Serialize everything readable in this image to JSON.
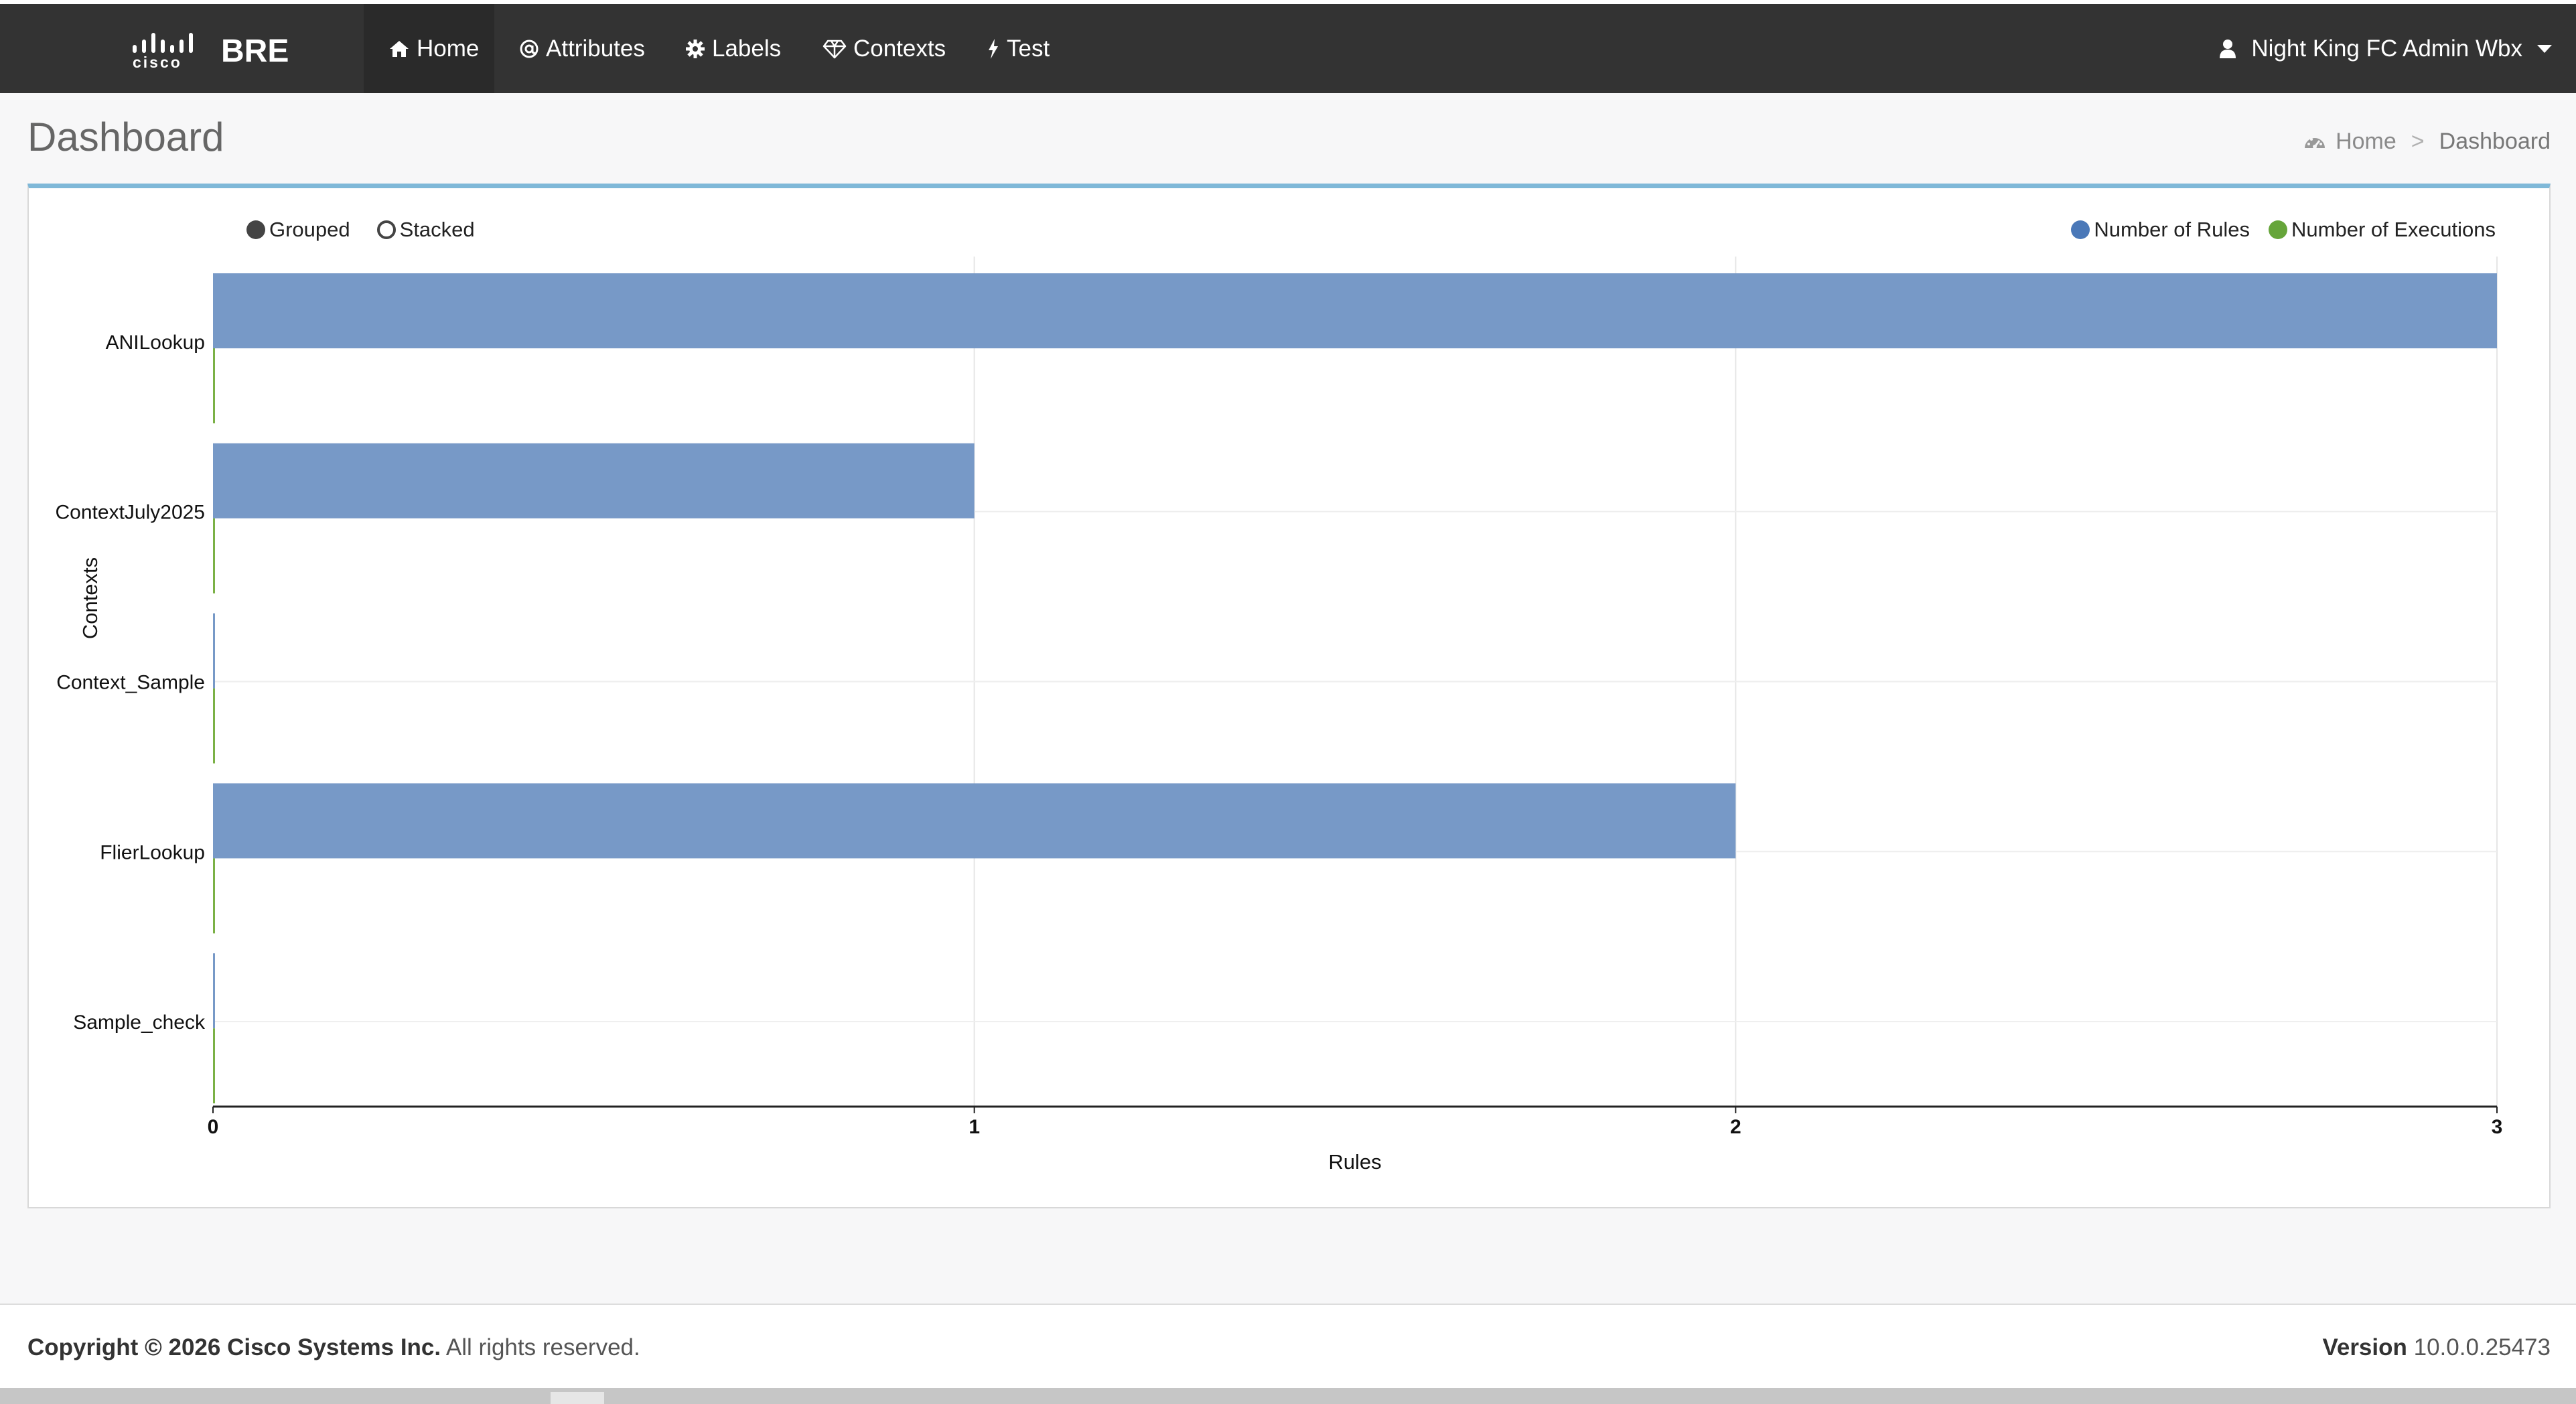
{
  "app": {
    "brand_logo_text": "cisco",
    "brand_name": "BRE"
  },
  "nav": {
    "items": [
      {
        "label": "Home",
        "icon": "home-icon"
      },
      {
        "label": "Attributes",
        "icon": "at-icon"
      },
      {
        "label": "Labels",
        "icon": "gear-icon"
      },
      {
        "label": "Contexts",
        "icon": "diamond-icon"
      },
      {
        "label": "Test",
        "icon": "bolt-icon"
      }
    ],
    "active": "Home",
    "user_label": "Night King FC Admin Wbx"
  },
  "page": {
    "title": "Dashboard",
    "breadcrumb": {
      "home": "Home",
      "separator": ">",
      "current": "Dashboard"
    }
  },
  "chart_controls": {
    "grouped_label": "Grouped",
    "stacked_label": "Stacked",
    "selected": "Grouped"
  },
  "chart_data": {
    "type": "bar",
    "orientation": "horizontal",
    "categories": [
      "ANILookup",
      "ContextJuly2025",
      "Context_Sample",
      "FlierLookup",
      "Sample_check"
    ],
    "series": [
      {
        "name": "Number of Rules",
        "color": "#7799c7",
        "legend_color": "#4a78b8",
        "values": [
          3,
          1,
          0,
          2,
          0
        ]
      },
      {
        "name": "Number of Executions",
        "color": "#7bb146",
        "legend_color": "#66a53a",
        "values": [
          0,
          0,
          0,
          0,
          0
        ]
      }
    ],
    "xlabel": "Rules",
    "ylabel": "Contexts",
    "xlim": [
      0,
      3
    ],
    "xticks": [
      0,
      1,
      2,
      3
    ],
    "grid": true,
    "legend_position": "top-right",
    "mode": "grouped"
  },
  "footer": {
    "copyright_bold": "Copyright © 2026 Cisco Systems Inc.",
    "copyright_rest": " All rights reserved.",
    "version_label": "Version",
    "version_value": "10.0.0.25473"
  },
  "colors": {
    "navbar": "#333333",
    "panel_accent": "#7fb8d8"
  }
}
